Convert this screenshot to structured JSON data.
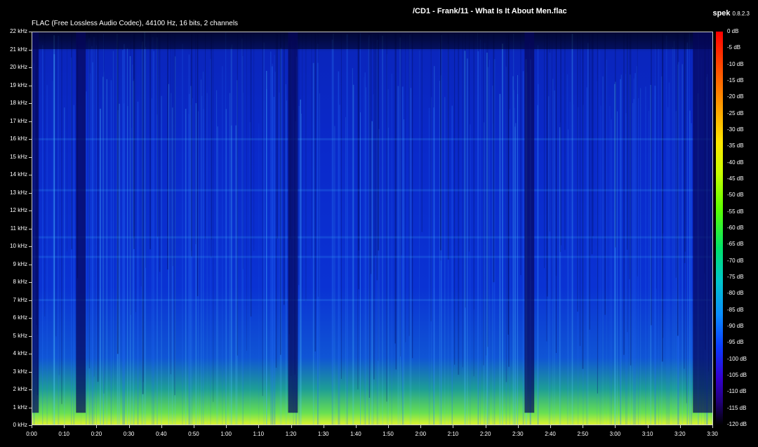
{
  "window": {
    "title": "/CD1 - Frank/11 - What Is It About Men.flac",
    "app_name": "spek",
    "app_version": "0.8.2.3"
  },
  "file_info": "FLAC (Free Lossless Audio Codec), 44100 Hz, 16 bits, 2 channels",
  "colors": {
    "background": "#000000",
    "axis": "#cfcfcf",
    "text": "#ffffff"
  },
  "chart_data": {
    "type": "heatmap",
    "title": "",
    "xlabel": "",
    "ylabel": "",
    "x_ticks": [
      "0:00",
      "0:10",
      "0:20",
      "0:30",
      "0:40",
      "0:50",
      "1:00",
      "1:10",
      "1:20",
      "1:30",
      "1:40",
      "1:50",
      "2:00",
      "2:10",
      "2:20",
      "2:30",
      "2:40",
      "2:50",
      "3:00",
      "3:10",
      "3:20",
      "3:30"
    ],
    "x_range_seconds": [
      0,
      210
    ],
    "y_ticks": [
      "0 kHz",
      "1 kHz",
      "2 kHz",
      "3 kHz",
      "4 kHz",
      "5 kHz",
      "6 kHz",
      "7 kHz",
      "8 kHz",
      "9 kHz",
      "10 kHz",
      "11 kHz",
      "12 kHz",
      "13 kHz",
      "14 kHz",
      "15 kHz",
      "16 kHz",
      "17 kHz",
      "18 kHz",
      "19 kHz",
      "20 kHz",
      "21 kHz",
      "22 kHz"
    ],
    "y_range_khz": [
      0,
      22
    ],
    "colorbar_ticks": [
      "0 dB",
      "-5 dB",
      "-10 dB",
      "-15 dB",
      "-20 dB",
      "-25 dB",
      "-30 dB",
      "-35 dB",
      "-40 dB",
      "-45 dB",
      "-50 dB",
      "-55 dB",
      "-60 dB",
      "-65 dB",
      "-70 dB",
      "-75 dB",
      "-80 dB",
      "-85 dB",
      "-90 dB",
      "-95 dB",
      "-100 dB",
      "-105 dB",
      "-110 dB",
      "-115 dB",
      "-120 dB"
    ],
    "colorbar_range_db": [
      -120,
      0
    ],
    "quiet_segments_seconds": [
      [
        0,
        2
      ],
      [
        13.5,
        16.5
      ],
      [
        79,
        82
      ],
      [
        152,
        155
      ],
      [
        204,
        210
      ]
    ]
  }
}
